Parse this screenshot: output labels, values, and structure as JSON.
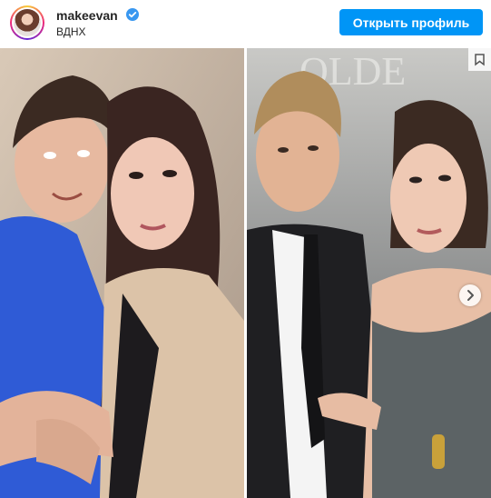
{
  "post": {
    "username": "makeevan",
    "location": "ВДНХ",
    "open_profile_label": "Открыть профиль"
  },
  "colors": {
    "accent": "#0095f6",
    "text": "#262626",
    "verified": "#3897f0"
  },
  "icons": {
    "verified": "verified-badge-icon",
    "next": "chevron-right-icon",
    "save": "bookmark-icon"
  }
}
